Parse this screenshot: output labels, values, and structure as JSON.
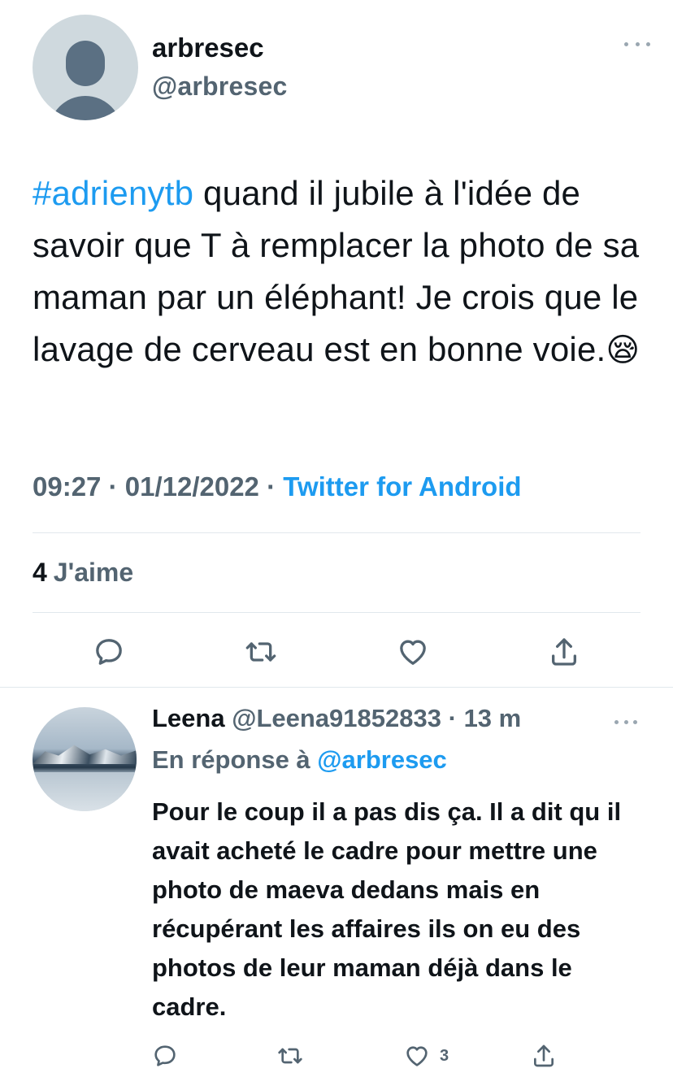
{
  "author": {
    "display_name": "arbresec",
    "handle": "@arbresec"
  },
  "tweet": {
    "hashtag": "#adrienytb",
    "text": " quand il jubile à l'idée de savoir que T à remplacer la photo de sa maman par un éléphant! Je crois que le lavage de cerveau est en bonne voie.",
    "emoji": "😪",
    "time": "09:27",
    "separator": " · ",
    "date": "01/12/2022",
    "source": "Twitter for Android",
    "likes_count": "4",
    "likes_label": "J'aime"
  },
  "actions": {
    "icons": [
      "reply-icon",
      "retweet-icon",
      "like-icon",
      "share-icon"
    ]
  },
  "reply": {
    "display_name": "Leena",
    "handle": "@Leena91852833",
    "dot": "·",
    "age": "13 m",
    "replying_prefix": "En réponse à ",
    "replying_to": "@arbresec",
    "text": "Pour le coup il a pas dis ça. Il a dit qu il avait acheté le cadre pour mettre une photo de maeva dedans mais en récupérant les affaires ils on eu des photos de leur maman déjà dans le cadre.",
    "like_count": "3"
  },
  "colors": {
    "accent": "#1d9bf0",
    "secondary_text": "#536471",
    "primary_text": "#0f1419",
    "divider": "#e1e8ed"
  }
}
